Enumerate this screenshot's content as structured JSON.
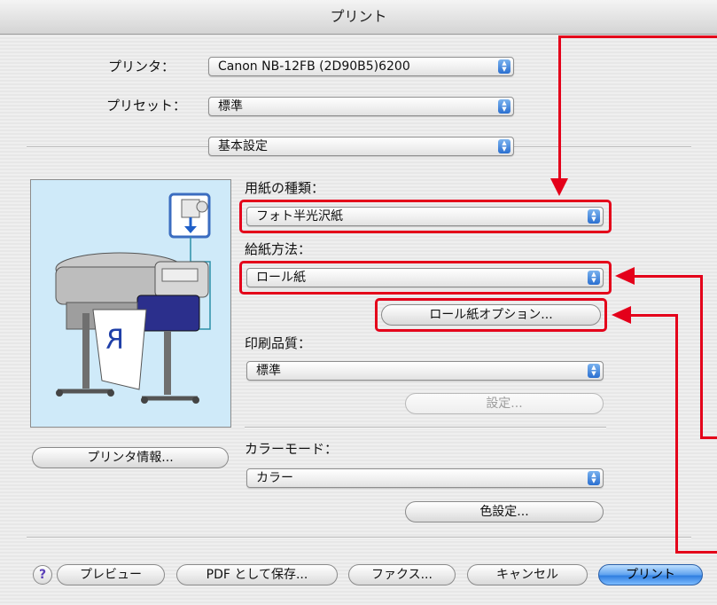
{
  "window": {
    "title": "プリント"
  },
  "printer": {
    "label": "プリンタ：",
    "value": "Canon NB-12FB (2D90B5)6200"
  },
  "preset": {
    "label": "プリセット：",
    "value": "標準"
  },
  "panel": {
    "value": "基本設定"
  },
  "media_type": {
    "label": "用紙の種類：",
    "value": "フォト半光沢紙"
  },
  "paper_source": {
    "label": "給紙方法：",
    "value": "ロール紙"
  },
  "roll_options": {
    "label": "ロール紙オプション..."
  },
  "print_quality": {
    "label": "印刷品質：",
    "value": "標準",
    "settings_label": "設定..."
  },
  "color_mode": {
    "label": "カラーモード：",
    "value": "カラー",
    "color_settings_label": "色設定..."
  },
  "printer_info": {
    "label": "プリンタ情報..."
  },
  "footer": {
    "help": "?",
    "preview": "プレビュー",
    "save_pdf": "PDF として保存...",
    "fax": "ファクス...",
    "cancel": "キャンセル",
    "print": "プリント"
  },
  "colors": {
    "highlight": "#e4001a",
    "default_button": "#2f7ee0",
    "preview_bg": "#cfeaf9"
  }
}
